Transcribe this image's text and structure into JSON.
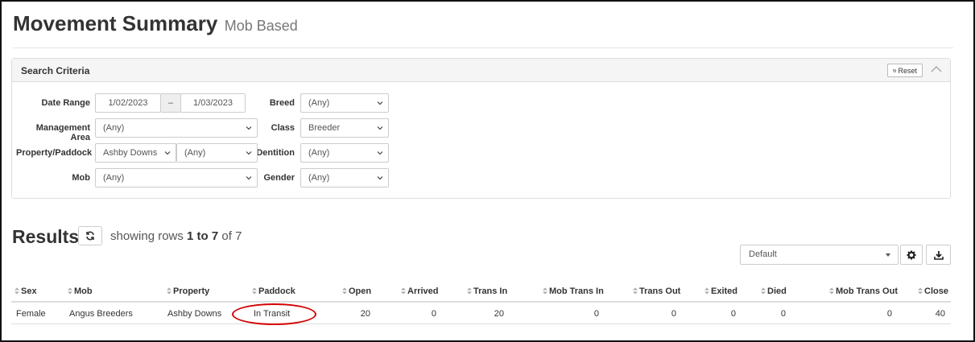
{
  "page": {
    "title": "Movement Summary",
    "subtitle": "Mob Based"
  },
  "search": {
    "title": "Search Criteria",
    "reset_label": "Reset",
    "labels": {
      "date_range": "Date Range",
      "management_area": "Management Area",
      "property_paddock": "Property/Paddock",
      "mob": "Mob",
      "breed": "Breed",
      "class": "Class",
      "dentition": "Dentition",
      "gender": "Gender"
    },
    "values": {
      "date_from": "1/02/2023",
      "date_sep": "–",
      "date_to": "1/03/2023",
      "management_area": "(Any)",
      "property": "Ashby Downs",
      "paddock": "(Any)",
      "mob": "(Any)",
      "breed": "(Any)",
      "class": "Breeder",
      "dentition": "(Any)",
      "gender": "(Any)"
    }
  },
  "results": {
    "title": "Results",
    "rows_prefix": "showing rows ",
    "rows_range": "1 to 7",
    "rows_suffix": " of 7",
    "view_selected": "Default"
  },
  "table": {
    "columns": [
      "Sex",
      "Mob",
      "Property",
      "Paddock",
      "Open",
      "Arrived",
      "Trans In",
      "Mob Trans In",
      "Trans Out",
      "Exited",
      "Died",
      "Mob Trans Out",
      "Close"
    ],
    "rows": [
      [
        "Female",
        "Angus Breeders",
        "Ashby Downs",
        "In Transit",
        "20",
        "0",
        "20",
        "0",
        "0",
        "0",
        "0",
        "0",
        "40"
      ]
    ]
  },
  "colors": {
    "highlight": "#d40000",
    "panel_header": "#f5f5f5"
  },
  "icons": [
    "reset-icon",
    "chevron-up-icon",
    "chevron-down-icon",
    "refresh-icon",
    "gear-icon",
    "download-icon",
    "sort-icon"
  ]
}
